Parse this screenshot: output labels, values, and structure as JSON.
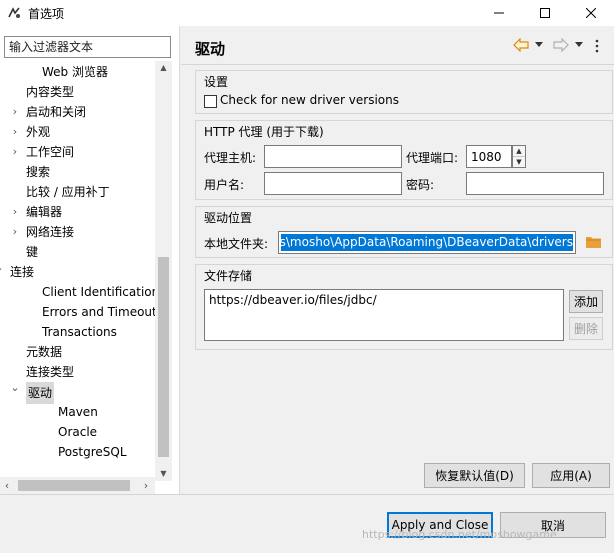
{
  "window": {
    "title": "首选项"
  },
  "left": {
    "filter_placeholder": "输入过滤器文本",
    "tree": [
      {
        "label": "Web 浏览器",
        "chevron": "",
        "indent": 2,
        "selected": false
      },
      {
        "label": "内容类型",
        "chevron": "",
        "indent": 1,
        "selected": false
      },
      {
        "label": "启动和关闭",
        "chevron": "›",
        "indent": 1,
        "selected": false
      },
      {
        "label": "外观",
        "chevron": "›",
        "indent": 1,
        "selected": false
      },
      {
        "label": "工作空间",
        "chevron": "›",
        "indent": 1,
        "selected": false
      },
      {
        "label": "搜索",
        "chevron": "",
        "indent": 1,
        "selected": false
      },
      {
        "label": "比较 / 应用补丁",
        "chevron": "",
        "indent": 1,
        "selected": false
      },
      {
        "label": "编辑器",
        "chevron": "›",
        "indent": 1,
        "selected": false
      },
      {
        "label": "网络连接",
        "chevron": "›",
        "indent": 1,
        "selected": false
      },
      {
        "label": "键",
        "chevron": "",
        "indent": 1,
        "selected": false
      },
      {
        "label": "连接",
        "chevron": "⌄",
        "indent": 0,
        "selected": false
      },
      {
        "label": "Client Identification",
        "chevron": "",
        "indent": 2,
        "selected": false
      },
      {
        "label": "Errors and Timeouts",
        "chevron": "",
        "indent": 2,
        "selected": false
      },
      {
        "label": "Transactions",
        "chevron": "",
        "indent": 2,
        "selected": false
      },
      {
        "label": "元数据",
        "chevron": "",
        "indent": 1,
        "selected": false
      },
      {
        "label": "连接类型",
        "chevron": "",
        "indent": 1,
        "selected": false
      },
      {
        "label": "驱动",
        "chevron": "⌄",
        "indent": 1,
        "selected": true
      },
      {
        "label": "Maven",
        "chevron": "",
        "indent": 3,
        "selected": false
      },
      {
        "label": "Oracle",
        "chevron": "",
        "indent": 3,
        "selected": false
      },
      {
        "label": "PostgreSQL",
        "chevron": "",
        "indent": 3,
        "selected": false
      }
    ]
  },
  "page": {
    "title": "驱动",
    "settings": {
      "group_title": "设置",
      "check_label": "Check for new driver versions",
      "checked": false
    },
    "proxy": {
      "group_title": "HTTP 代理 (用于下载)",
      "host_label": "代理主机:",
      "host_value": "",
      "port_label": "代理端口:",
      "port_value": "1080",
      "user_label": "用户名:",
      "user_value": "",
      "pass_label": "密码:",
      "pass_value": ""
    },
    "location": {
      "group_title": "驱动位置",
      "local_label": "本地文件夹:",
      "local_value": "C:\\Users\\mosho\\AppData\\Roaming\\DBeaverData\\drivers"
    },
    "storage": {
      "group_title": "文件存储",
      "items": [
        "https://dbeaver.io/files/jdbc/"
      ],
      "add_label": "添加",
      "remove_label": "删除"
    },
    "restore_label": "恢复默认值(D)",
    "apply_label": "应用(A)"
  },
  "footer": {
    "apply_close_label": "Apply and Close",
    "cancel_label": "取消",
    "watermark": "https://blog.csdn.net/moshowgame"
  },
  "colors": {
    "selection": "#0078d7",
    "folder": "#e8a13a",
    "nav_back": "#e8a13a"
  }
}
